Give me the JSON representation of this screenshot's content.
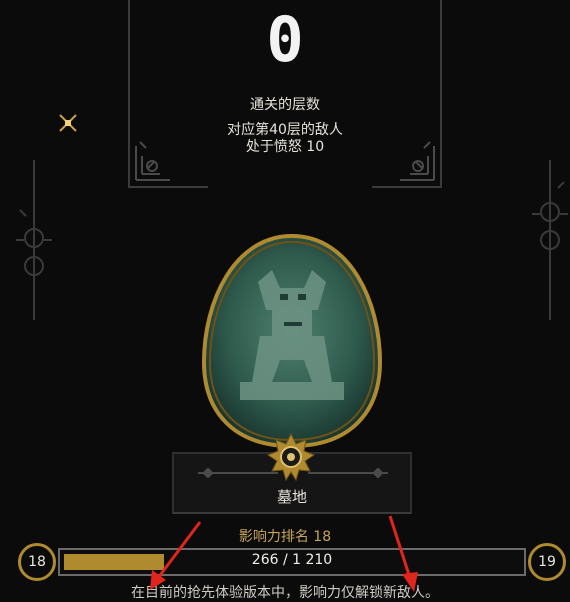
{
  "header": {
    "count": "0",
    "floors_label": "通关的层数",
    "enemy_line1": "对应第40层的敌人",
    "enemy_line2": "处于愤怒 10"
  },
  "location": {
    "name": "墓地"
  },
  "influence": {
    "rank_label": "影响力排名 18",
    "progress_text": "266 / 1 210",
    "progress_fraction": 0.22,
    "current_level": "18",
    "next_level": "19"
  },
  "footer": {
    "note": "在目前的抢先体验版本中，影响力仅解锁新敌人。"
  },
  "colors": {
    "gold": "#b08a2e",
    "portrait_green": "#2e5a4c",
    "arrow_red": "#e0261c"
  },
  "icons": {
    "sparkle": "sparkle-icon",
    "emblem": "sun-emblem-icon"
  }
}
